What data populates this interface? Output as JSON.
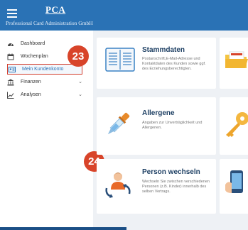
{
  "header": {
    "logo": "PCA",
    "company": "Professional Card Administration GmbH"
  },
  "sidebar": {
    "items": [
      {
        "label": "Dashboard",
        "icon": "dashboard-icon"
      },
      {
        "label": "Wochenplan",
        "icon": "calendar-icon"
      },
      {
        "label": "Mein Kundenkonto",
        "icon": "id-card-icon",
        "active": true
      },
      {
        "label": "Finanzen",
        "icon": "bank-icon"
      },
      {
        "label": "Analysen",
        "icon": "chart-icon"
      }
    ]
  },
  "callouts": {
    "one": "23",
    "two": "24"
  },
  "cards": [
    {
      "title": "Stammdaten",
      "desc": "Postanschrift,E-Mail-Adresse und Kontaktdaten des Kunden sowie ggf. des Erziehungsberechtigten."
    },
    {
      "title": "Allergene",
      "desc": "Angaben zur Unverträglichkeit und Allergenen."
    },
    {
      "title": "Person wechseln",
      "desc": "Wechseln Sie zwischen verschiedenen Personen (z.B. Kinder) innerhalb des selben Vertrags."
    }
  ],
  "colors": {
    "header": "#2a72b5",
    "accent": "#d8442a",
    "title": "#1d3f63"
  }
}
